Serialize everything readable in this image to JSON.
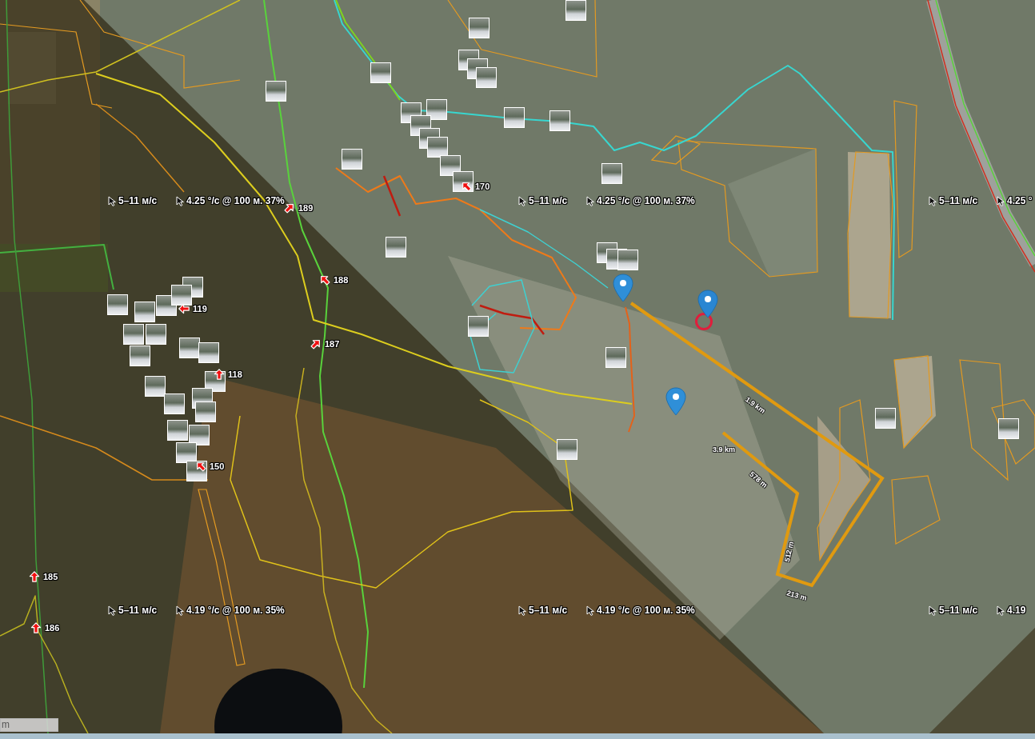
{
  "wind_labels": [
    {
      "speed": "5–11 м/с",
      "detail": "4.25 °/с @ 100 м. 37%"
    },
    {
      "speed": "5–11 м/с",
      "detail": "4.25 °/с @ 100 м. 37%"
    },
    {
      "speed": "5–11 м/с",
      "detail": "4.25 °"
    },
    {
      "speed": "5–11 м/с",
      "detail": "4.19 °/с @ 100 м. 35%"
    },
    {
      "speed": "5–11 м/с",
      "detail": "4.19 °/с @ 100 м. 35%"
    },
    {
      "speed": "5–11 м/с",
      "detail": "4.19"
    }
  ],
  "track_points": [
    {
      "label": "170"
    },
    {
      "label": "189"
    },
    {
      "label": "188"
    },
    {
      "label": "119"
    },
    {
      "label": "187"
    },
    {
      "label": "118"
    },
    {
      "label": "150"
    },
    {
      "label": "185"
    },
    {
      "label": "186"
    }
  ],
  "markers": [
    {
      "selected": false
    },
    {
      "selected": true
    },
    {
      "selected": false
    }
  ],
  "distance_labels": [
    "1.9 km",
    "3.9 km",
    "578 m",
    "512 m",
    "213 m"
  ],
  "scale_bar": {
    "label": "m"
  }
}
